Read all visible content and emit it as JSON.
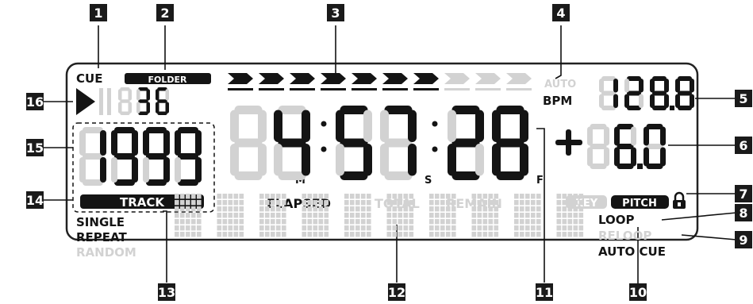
{
  "callouts": [
    "1",
    "2",
    "3",
    "4",
    "5",
    "6",
    "7",
    "8",
    "9",
    "10",
    "11",
    "12",
    "13",
    "14",
    "15",
    "16"
  ],
  "cue_label": "CUE",
  "folder_label": "FOLDER",
  "folder_number": "136",
  "track_number": "1999",
  "track_label": "TRACK",
  "time": {
    "minutes": "04",
    "seconds": "57",
    "frames": "28",
    "m_unit": "M",
    "s_unit": "S",
    "f_unit": "F"
  },
  "time_modes": [
    "ELAPSED",
    "TOTAL",
    "REMAIN"
  ],
  "time_mode_active": "ELAPSED",
  "auto_label": "AUTO",
  "bpm_label": "BPM",
  "bpm_value": "128.8",
  "pitch_sign": "+",
  "pitch_value": "06.0",
  "key_label": "KEY",
  "pitch_label": "PITCH",
  "lock_icon": "lock-icon",
  "play_pause_icon": "play-pause-icon",
  "play_mode_single": "SINGLE",
  "play_mode_repeat": "REPEAT",
  "play_mode_random": "RANDOM",
  "loop_label": "LOOP",
  "reloop_label": "RELOOP",
  "auto_cue_label": "AUTO CUE",
  "progress": {
    "total_segments": 10,
    "active_segments": 7
  },
  "text_matrix_cells": 10,
  "colors": {
    "lit": "#141414",
    "unlit": "#d2d2d2",
    "callout_bg": "#1a1a1a",
    "callout_fg": "#ffffff"
  }
}
